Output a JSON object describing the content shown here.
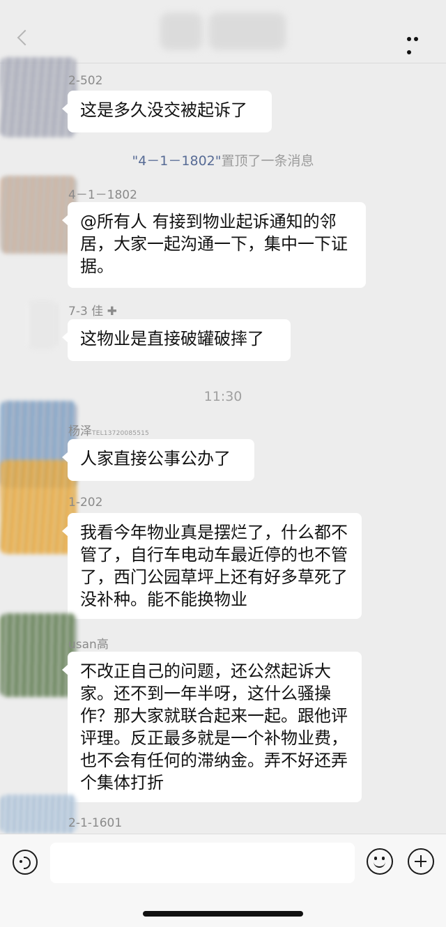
{
  "header": {
    "more_label": "更多"
  },
  "messages": [
    {
      "nick": "2-502",
      "text": "这是多久没交被起诉了"
    },
    {
      "nick": "4－1－1802",
      "text": "@所有人 有接到物业起诉通知的邻居，大家一起沟通一下，集中一下证据。"
    },
    {
      "nick": "7-3 佳 ✚",
      "text": "这物业是直接破罐破摔了"
    },
    {
      "nick": "杨泽",
      "nick_extra": "TEL13720085515",
      "text": "人家直接公事公办了"
    },
    {
      "nick": "1-202",
      "text": "我看今年物业真是摆烂了，什么都不管了，自行车电动车最近停的也不管了，西门公园草坪上还有好多草死了没补种。能不能换物业"
    },
    {
      "nick": "usan高",
      "text": "不改正自己的问题，还公然起诉大家。还不到一年半呀，这什么骚操作？那大家就联合起来一起。跟他评评理。反正最多就是一个补物业费，也不会有任何的滞纳金。弄不好还弄个集体打折"
    },
    {
      "nick": "2-1-1601"
    }
  ],
  "system_notice": {
    "quoted": "\"4－1－1802\"",
    "text": "置顶了一条消息"
  },
  "timestamp": "11:30",
  "colors": {
    "background": "#ededed",
    "bubble": "#ffffff",
    "link": "#576b95",
    "meta_text": "#8a8a8a"
  },
  "icons": {
    "back": "chevron-left-icon",
    "more": "more-dots-icon",
    "voice": "voice-icon",
    "emoji": "emoji-icon",
    "plus": "plus-icon"
  }
}
